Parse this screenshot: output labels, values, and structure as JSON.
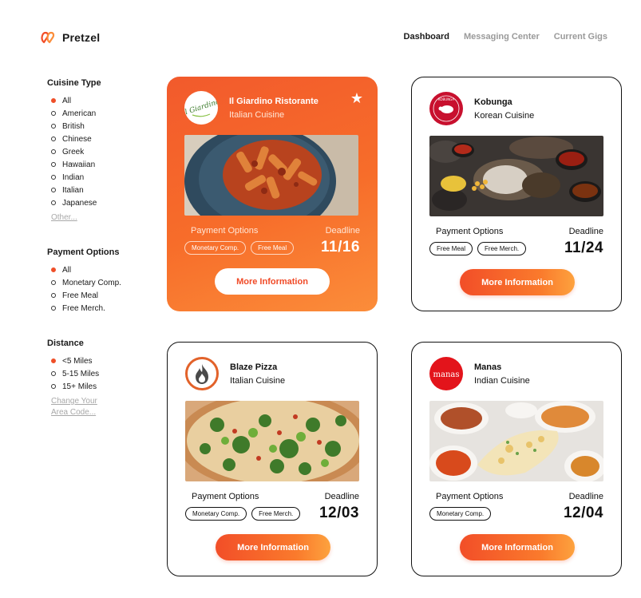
{
  "app": {
    "name": "Pretzel"
  },
  "nav": {
    "items": [
      {
        "label": "Dashboard",
        "active": true
      },
      {
        "label": "Messaging Center",
        "active": false
      },
      {
        "label": "Current Gigs",
        "active": false
      }
    ]
  },
  "filters": {
    "cuisine": {
      "title": "Cuisine Type",
      "options": [
        "All",
        "American",
        "British",
        "Chinese",
        "Greek",
        "Hawaiian",
        "Indian",
        "Italian",
        "Japanese"
      ],
      "selected": "All",
      "more_label": "Other..."
    },
    "payment": {
      "title": "Payment Options",
      "options": [
        "All",
        "Monetary Comp.",
        "Free Meal",
        "Free Merch."
      ],
      "selected": "All"
    },
    "distance": {
      "title": "Distance",
      "options": [
        "<5 Miles",
        "5-15 Miles",
        "15+ Miles"
      ],
      "selected": "<5 Miles",
      "change_label": "Change Your Area Code..."
    }
  },
  "cards": [
    {
      "name": "Il Giardino Ristorante",
      "cuisine": "Italian Cuisine",
      "logo_text": "Il Giardino",
      "featured": true,
      "starred": true,
      "payment_label": "Payment Options",
      "tags": [
        "Monetary Comp.",
        "Free Meal"
      ],
      "deadline_label": "Deadline",
      "deadline": "11/16",
      "button_label": "More Information",
      "photo": "pasta-photo"
    },
    {
      "name": "Kobunga",
      "cuisine": "Korean Cuisine",
      "logo_text": "KOBUNGA",
      "featured": false,
      "payment_label": "Payment Options",
      "tags": [
        "Free Meal",
        "Free Merch."
      ],
      "deadline_label": "Deadline",
      "deadline": "11/24",
      "button_label": "More Information",
      "photo": "korean-bbq-photo"
    },
    {
      "name": "Blaze Pizza",
      "cuisine": "Italian Cuisine",
      "featured": false,
      "payment_label": "Payment Options",
      "tags": [
        "Monetary Comp.",
        "Free Merch."
      ],
      "deadline_label": "Deadline",
      "deadline": "12/03",
      "button_label": "More Information",
      "photo": "pizza-photo"
    },
    {
      "name": "Manas",
      "cuisine": "Indian Cuisine",
      "logo_text": "manas",
      "featured": false,
      "payment_label": "Payment Options",
      "tags": [
        "Monetary Comp."
      ],
      "deadline_label": "Deadline",
      "deadline": "12/04",
      "button_label": "More Information",
      "photo": "indian-food-photo"
    }
  ],
  "colors": {
    "accent": "#f24e28",
    "accent_light": "#fb8d3a",
    "text": "#1a1a1a",
    "muted": "#9a9a9a"
  }
}
